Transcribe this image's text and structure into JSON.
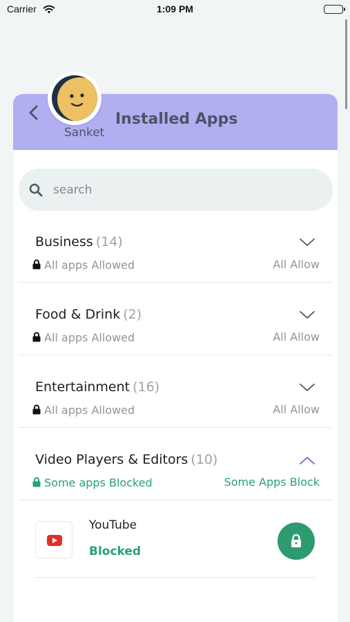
{
  "status_bar": {
    "carrier": "Carrier",
    "time": "1:09 PM"
  },
  "header": {
    "title": "Installed Apps",
    "username": "Sanket"
  },
  "search": {
    "placeholder": "search"
  },
  "categories": [
    {
      "name": "Business",
      "count": "(14)",
      "status": "All apps Allowed",
      "action": "All Allow",
      "expanded": false
    },
    {
      "name": "Food & Drink",
      "count": "(2)",
      "status": "All apps Allowed",
      "action": "All Allow",
      "expanded": false
    },
    {
      "name": "Entertainment",
      "count": "(16)",
      "status": "All apps Allowed",
      "action": "All Allow",
      "expanded": false
    },
    {
      "name": "Video Players & Editors",
      "count": "(10)",
      "status": "Some apps Blocked",
      "action": "Some Apps Block",
      "expanded": true
    }
  ],
  "apps": [
    {
      "name": "YouTube",
      "status": "Blocked",
      "icon": "youtube-icon"
    }
  ],
  "colors": {
    "header_bg": "#b2aff0",
    "accent_green": "#27a372",
    "lock_button": "#2c9c70",
    "muted_text": "#8b969b"
  }
}
